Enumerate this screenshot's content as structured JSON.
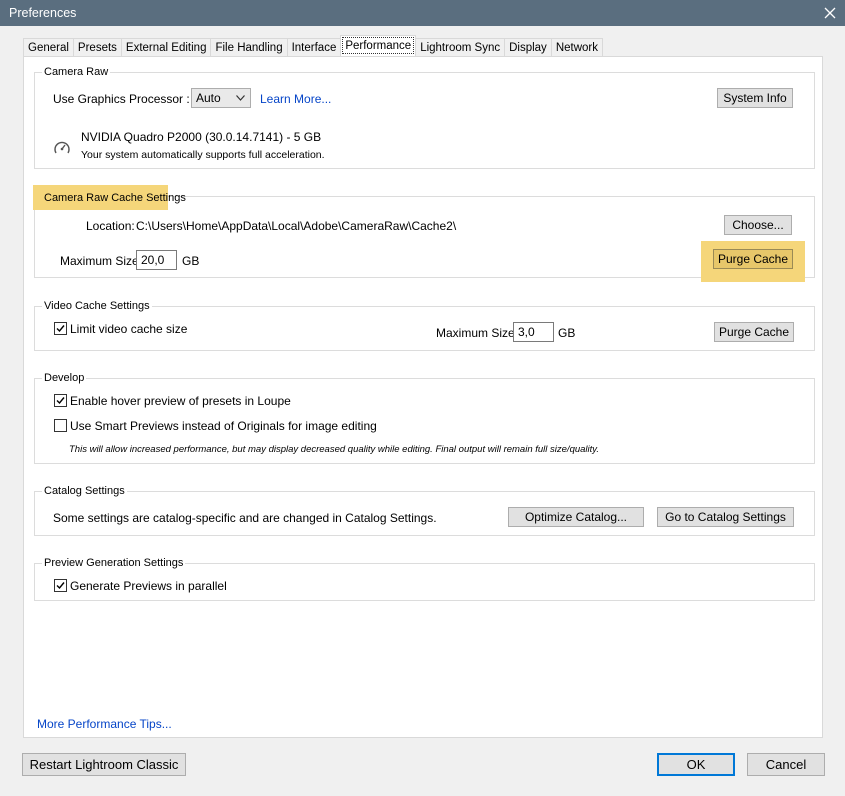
{
  "window": {
    "title": "Preferences"
  },
  "tabs": [
    {
      "label": "General"
    },
    {
      "label": "Presets"
    },
    {
      "label": "External Editing"
    },
    {
      "label": "File Handling"
    },
    {
      "label": "Interface"
    },
    {
      "label": "Performance",
      "active": true
    },
    {
      "label": "Lightroom Sync"
    },
    {
      "label": "Display"
    },
    {
      "label": "Network"
    }
  ],
  "camera_raw": {
    "title": "Camera Raw",
    "gpu_label": "Use Graphics Processor :",
    "gpu_value": "Auto",
    "learn_more": "Learn More...",
    "system_info": "System Info",
    "gpu_name": "NVIDIA Quadro P2000 (30.0.14.7141) - 5 GB",
    "gpu_status": "Your system automatically supports full acceleration."
  },
  "cache": {
    "title": "Camera Raw Cache Settings",
    "location_label": "Location:",
    "location_value": "C:\\Users\\Home\\AppData\\Local\\Adobe\\CameraRaw\\Cache2\\",
    "choose": "Choose...",
    "max_size_label": "Maximum Size:",
    "max_size_value": "20,0",
    "unit": "GB",
    "purge": "Purge Cache"
  },
  "video_cache": {
    "title": "Video Cache Settings",
    "limit_label": "Limit video cache size",
    "max_size_label": "Maximum Size:",
    "max_size_value": "3,0",
    "unit": "GB",
    "purge": "Purge Cache"
  },
  "develop": {
    "title": "Develop",
    "hover_label": "Enable hover preview of presets in Loupe",
    "smart_label": "Use Smart Previews instead of Originals for image editing",
    "smart_note": "This will allow increased performance, but may display decreased quality while editing. Final output will remain full size/quality."
  },
  "catalog": {
    "title": "Catalog Settings",
    "text": "Some settings are catalog-specific and are changed in Catalog Settings.",
    "optimize": "Optimize Catalog...",
    "goto": "Go to Catalog Settings"
  },
  "preview": {
    "title": "Preview Generation Settings",
    "parallel_label": "Generate Previews in parallel"
  },
  "more_tips": "More Performance Tips...",
  "footer": {
    "restart": "Restart Lightroom Classic",
    "ok": "OK",
    "cancel": "Cancel"
  },
  "colors": {
    "titlebar": "#5a6e7f",
    "highlight": "#f5d67a",
    "link": "#0645c8"
  }
}
